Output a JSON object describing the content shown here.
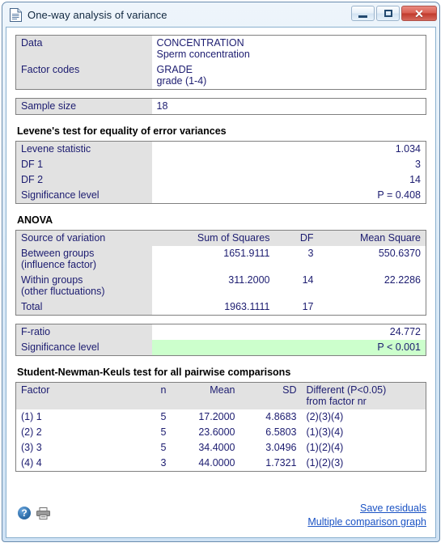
{
  "window": {
    "title": "One-way analysis of variance",
    "icon": "document-icon",
    "buttons": {
      "minimize": "–",
      "maximize": "□",
      "close": "✕"
    }
  },
  "info_table": {
    "rows": [
      {
        "label": "Data",
        "value_main": "CONCENTRATION",
        "value_sub": "Sperm concentration"
      },
      {
        "label": "Factor codes",
        "value_main": "GRADE",
        "value_sub": "grade (1-4)"
      }
    ]
  },
  "sample_size": {
    "label": "Sample size",
    "value": "18"
  },
  "levene": {
    "heading": "Levene's test for equality of error variances",
    "rows": [
      {
        "label": "Levene statistic",
        "value": "1.034"
      },
      {
        "label": "DF 1",
        "value": "3"
      },
      {
        "label": "DF 2",
        "value": "14"
      },
      {
        "label": "Significance level",
        "value": "P = 0.408"
      }
    ]
  },
  "anova": {
    "heading": "ANOVA",
    "columns": [
      "Source of variation",
      "Sum of Squares",
      "DF",
      "Mean Square"
    ],
    "rows": [
      {
        "source": "Between groups",
        "source_sub": "(influence factor)",
        "ss": "1651.9111",
        "df": "3",
        "ms": "550.6370"
      },
      {
        "source": "Within groups",
        "source_sub": "(other fluctuations)",
        "ss": "311.2000",
        "df": "14",
        "ms": "22.2286"
      },
      {
        "source": "Total",
        "source_sub": "",
        "ss": "1963.1111",
        "df": "17",
        "ms": ""
      }
    ]
  },
  "fratio": {
    "rows": [
      {
        "label": "F-ratio",
        "value": "24.772",
        "highlight": false
      },
      {
        "label": "Significance level",
        "value": "P < 0.001",
        "highlight": true
      }
    ],
    "highlight_color": "#ccffcc"
  },
  "snk": {
    "heading": "Student-Newman-Keuls test for all pairwise comparisons",
    "columns": [
      "Factor",
      "n",
      "Mean",
      "SD",
      "Different (P<0.05)",
      "from factor nr"
    ],
    "rows": [
      {
        "factor": "(1) 1",
        "n": "5",
        "mean": "17.2000",
        "sd": "4.8683",
        "different": "(2)(3)(4)"
      },
      {
        "factor": "(2) 2",
        "n": "5",
        "mean": "23.6000",
        "sd": "6.5803",
        "different": "(1)(3)(4)"
      },
      {
        "factor": "(3) 3",
        "n": "5",
        "mean": "34.4000",
        "sd": "3.0496",
        "different": "(1)(2)(4)"
      },
      {
        "factor": "(4) 4",
        "n": "3",
        "mean": "44.0000",
        "sd": "1.7321",
        "different": "(1)(2)(3)"
      }
    ]
  },
  "footer": {
    "help_icon": "?",
    "print_icon": "printer-icon",
    "links": [
      "Save residuals",
      "Multiple comparison graph"
    ]
  },
  "colors": {
    "label_bg": "#e2e2e2",
    "value_text": "#1c1c70",
    "link": "#1a52c4",
    "border": "#808080",
    "highlight_green": "#ccffcc"
  }
}
